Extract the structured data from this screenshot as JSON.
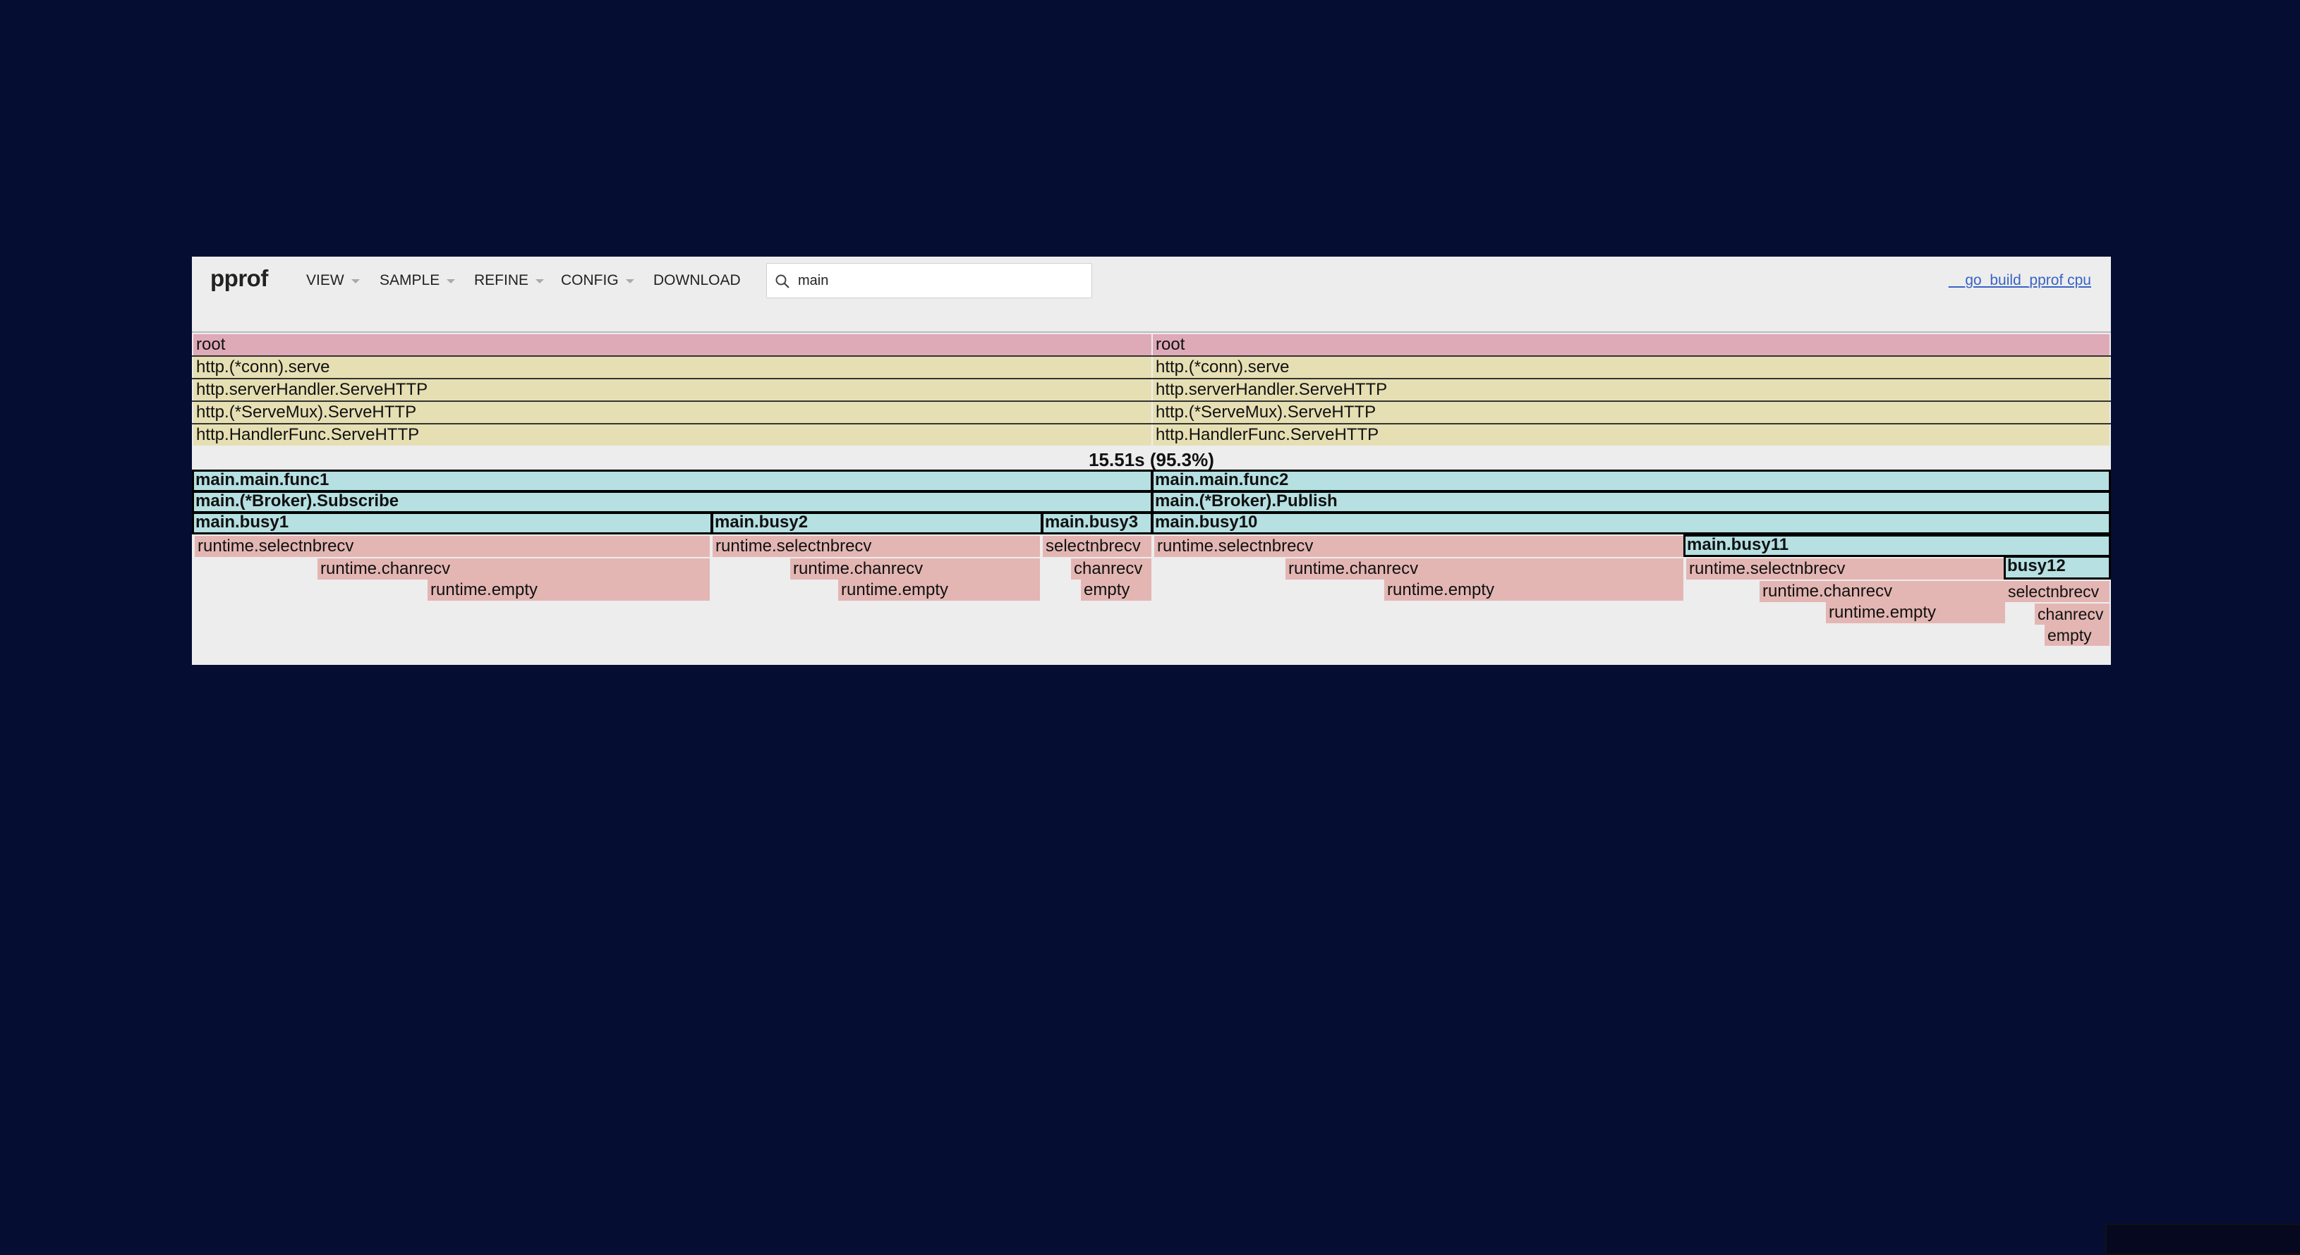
{
  "toolbar": {
    "logo": "pprof",
    "menus": [
      "VIEW",
      "SAMPLE",
      "REFINE",
      "CONFIG",
      "DOWNLOAD"
    ],
    "search_value": "main",
    "profile_link": "__go_build_pprof cpu"
  },
  "flame": {
    "total_label": "15.51s (95.3%)",
    "left": {
      "root": "root",
      "stack": [
        "http.(*conn).serve",
        "http.serverHandler.ServeHTTP",
        "http.(*ServeMux).ServeHTTP",
        "http.HandlerFunc.ServeHTTP"
      ],
      "func": "main.main.func1",
      "broker": "main.(*Broker).Subscribe",
      "busy1": {
        "name": "main.busy1",
        "sel": "runtime.selectnbrecv",
        "chan": "runtime.chanrecv",
        "empty": "runtime.empty"
      },
      "busy2": {
        "name": "main.busy2",
        "sel": "runtime.selectnbrecv",
        "chan": "runtime.chanrecv",
        "empty": "runtime.empty"
      },
      "busy3": {
        "name": "main.busy3",
        "sel": "selectnbrecv",
        "chan": "chanrecv",
        "empty": "empty"
      }
    },
    "right": {
      "root": "root",
      "stack": [
        "http.(*conn).serve",
        "http.serverHandler.ServeHTTP",
        "http.(*ServeMux).ServeHTTP",
        "http.HandlerFunc.ServeHTTP"
      ],
      "func": "main.main.func2",
      "broker": "main.(*Broker).Publish",
      "busy10": {
        "name": "main.busy10",
        "sel": "runtime.selectnbrecv",
        "chan": "runtime.chanrecv",
        "empty": "runtime.empty"
      },
      "busy11": {
        "name": "main.busy11",
        "sel": "runtime.selectnbrecv",
        "chan": "runtime.chanrecv",
        "empty": "runtime.empty"
      },
      "busy12": {
        "name": "busy12",
        "sel": "selectnbrecv",
        "chan": "chanrecv",
        "empty": "empty"
      }
    }
  },
  "colors": {
    "background": "#050d33",
    "panel": "#ededed",
    "root": "#dfaab8",
    "http": "#e6dfb3",
    "main": "#b6e0e2",
    "runtime": "#e3b6b3",
    "link": "#3a63c4"
  }
}
